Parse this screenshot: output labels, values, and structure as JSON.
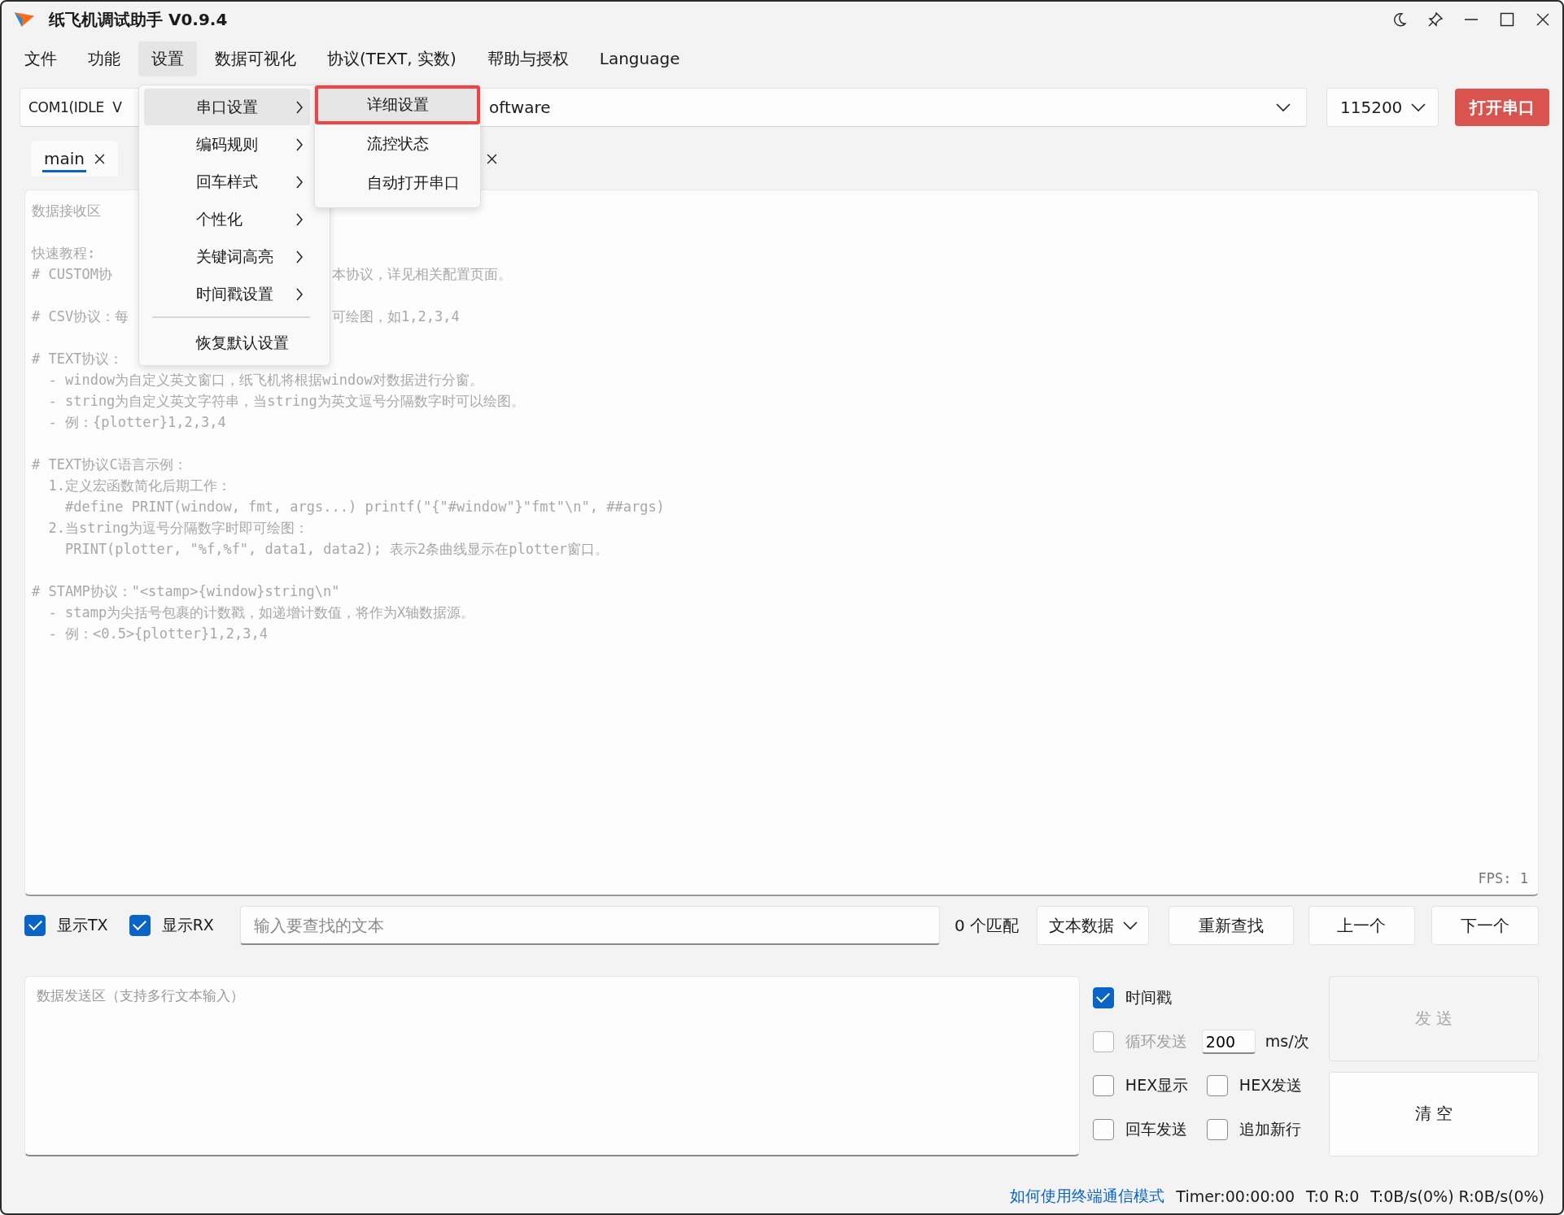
{
  "window": {
    "title": "纸飞机调试助手 V0.9.4"
  },
  "menu_bar": [
    {
      "label": "文件",
      "selected": false
    },
    {
      "label": "功能",
      "selected": false
    },
    {
      "label": "设置",
      "selected": true
    },
    {
      "label": "数据可视化",
      "selected": false
    },
    {
      "label": "协议(TEXT, 实数)",
      "selected": false
    },
    {
      "label": "帮助与授权",
      "selected": false
    },
    {
      "label": "Language",
      "selected": false
    }
  ],
  "open_menu": {
    "items": [
      {
        "kind": "submenu",
        "label": "串口设置",
        "selected": true
      },
      {
        "kind": "submenu",
        "label": "编码规则",
        "selected": false
      },
      {
        "kind": "submenu",
        "label": "回车样式",
        "selected": false
      },
      {
        "kind": "submenu",
        "label": "个性化",
        "selected": false
      },
      {
        "kind": "submenu",
        "label": "关键词高亮",
        "selected": false
      },
      {
        "kind": "submenu",
        "label": "时间戳设置",
        "selected": false
      },
      {
        "kind": "separator"
      },
      {
        "kind": "action",
        "label": "恢复默认设置",
        "selected": false
      }
    ],
    "submenu": [
      {
        "label": "详细设置",
        "selected": true
      },
      {
        "label": "流控状态",
        "selected": false
      },
      {
        "label": "自动打开串口",
        "selected": false
      }
    ]
  },
  "port_select": {
    "value_start": "COM1(IDLE  V",
    "value_end": "oftware"
  },
  "baud_select": {
    "value": "115200"
  },
  "open_button": "打开串口",
  "tabs": [
    {
      "label": "main",
      "selected": true
    },
    {
      "selected": false
    }
  ],
  "receive_area": {
    "blocks": [
      [
        {
          "text": "数据接收区"
        }
      ],
      [
        {
          "text": "快速教程:"
        },
        {
          "text": "# CUSTOM协",
          "right": "本协议，详见相关配置页面。"
        }
      ],
      [
        {
          "text": "# CSV协议：每",
          "right": "可绘图，如1,2,3,4"
        }
      ],
      [
        {
          "text": "# TEXT协议："
        },
        {
          "text": "  - window为自定义英文窗口，纸飞机将根据window对数据进行分窗。"
        },
        {
          "text": "  - string为自定义英文字符串，当string为英文逗号分隔数字时可以绘图。"
        },
        {
          "text": "  - 例：{plotter}1,2,3,4"
        }
      ],
      [
        {
          "text": "# TEXT协议C语言示例："
        },
        {
          "text": "  1.定义宏函数简化后期工作："
        },
        {
          "text": "    #define PRINT(window, fmt, args...) printf(\"{\"#window\"}\"fmt\"\\n\", ##args)"
        },
        {
          "text": "  2.当string为逗号分隔数字时即可绘图："
        },
        {
          "text": "    PRINT(plotter, \"%f,%f\", data1, data2); 表示2条曲线显示在plotter窗口。"
        }
      ],
      [
        {
          "text": "# STAMP协议：\"<stamp>{window}string\\n\""
        },
        {
          "text": "  - stamp为尖括号包裹的计数戳，如递增计数值，将作为X轴数据源。"
        },
        {
          "text": "  - 例：<0.5>{plotter}1,2,3,4"
        }
      ]
    ],
    "fps": "FPS: 1"
  },
  "search_row": {
    "toggles": [
      {
        "label": "显示TX",
        "checked": true
      },
      {
        "label": "显示RX",
        "checked": true
      }
    ],
    "search": {
      "placeholder": "输入要查找的文本"
    },
    "match_count": "0 个匹配",
    "mode_select": "文本数据",
    "buttons": [
      "重新查找",
      "上一个",
      "下一个"
    ]
  },
  "send_area": {
    "placeholder": "数据发送区（支持多行文本输入）"
  },
  "send_options": [
    {
      "kind": "check",
      "label": "时间戳",
      "checked": true,
      "disabled": false
    },
    {
      "kind": "interval",
      "label": "循环发送",
      "checked": false,
      "disabled": true,
      "value": "200",
      "unit": "ms/次"
    },
    {
      "kind": "check",
      "label": "HEX显示",
      "checked": false,
      "disabled": false
    },
    {
      "kind": "check",
      "label": "HEX发送",
      "checked": false,
      "disabled": false
    },
    {
      "kind": "check",
      "label": "回车发送",
      "checked": false,
      "disabled": false
    },
    {
      "kind": "check",
      "label": "追加新行",
      "checked": false,
      "disabled": false
    }
  ],
  "send_button": {
    "label": "发 送",
    "disabled": true
  },
  "clear_button": "清 空",
  "status_bar": {
    "link": "如何使用终端通信模式",
    "items": [
      "Timer:00:00:00",
      "T:0 R:0",
      "T:0B/s(0%) R:0B/s(0%)"
    ]
  }
}
